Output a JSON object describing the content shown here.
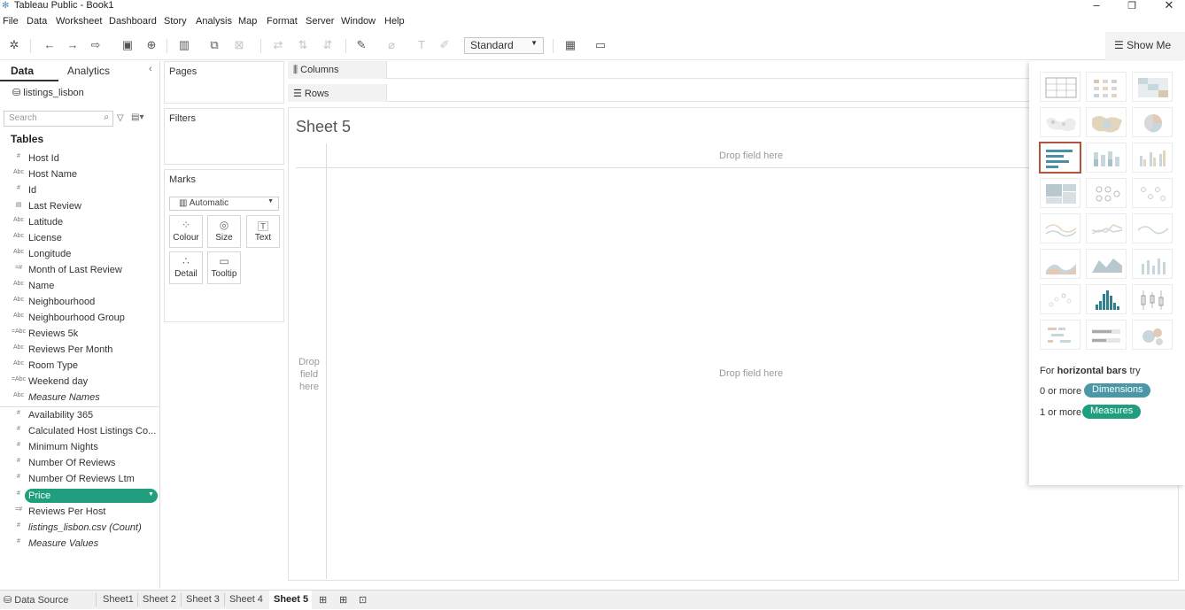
{
  "window": {
    "title": "Tableau Public - Book1",
    "minimize": "–",
    "restore": "❐",
    "close": "✕"
  },
  "menu": [
    "File",
    "Data",
    "Worksheet",
    "Dashboard",
    "Story",
    "Analysis",
    "Map",
    "Format",
    "Server",
    "Window",
    "Help"
  ],
  "toolbar": {
    "fit_select": "Standard",
    "show_me_label": "Show Me"
  },
  "datapane": {
    "tab_data": "Data",
    "tab_analytics": "Analytics",
    "datasource": "listings_lisbon",
    "search_placeholder": "Search",
    "tables_heading": "Tables",
    "fields": [
      {
        "icon": "#",
        "label": "Host Id"
      },
      {
        "icon": "Abc",
        "label": "Host Name"
      },
      {
        "icon": "#",
        "label": "Id"
      },
      {
        "icon": "▤",
        "label": "Last Review"
      },
      {
        "icon": "Abc",
        "label": "Latitude"
      },
      {
        "icon": "Abc",
        "label": "License"
      },
      {
        "icon": "Abc",
        "label": "Longitude"
      },
      {
        "icon": "=#",
        "label": "Month of Last Review"
      },
      {
        "icon": "Abc",
        "label": "Name"
      },
      {
        "icon": "Abc",
        "label": "Neighbourhood"
      },
      {
        "icon": "Abc",
        "label": "Neighbourhood Group"
      },
      {
        "icon": "=Abc",
        "label": "Reviews 5k"
      },
      {
        "icon": "Abc",
        "label": "Reviews Per Month"
      },
      {
        "icon": "Abc",
        "label": "Room Type"
      },
      {
        "icon": "=Abc",
        "label": "Weekend day"
      },
      {
        "icon": "Abc",
        "label": "Measure Names"
      }
    ],
    "measures": [
      {
        "icon": "#",
        "label": "Availability 365"
      },
      {
        "icon": "#",
        "label": "Calculated Host Listings Co..."
      },
      {
        "icon": "#",
        "label": "Minimum Nights"
      },
      {
        "icon": "#",
        "label": "Number Of Reviews"
      },
      {
        "icon": "#",
        "label": "Number Of Reviews Ltm"
      },
      {
        "icon": "#",
        "label": "Price"
      },
      {
        "icon": "=#",
        "label": "Reviews Per Host"
      },
      {
        "icon": "#",
        "label": "listings_lisbon.csv (Count)"
      },
      {
        "icon": "#",
        "label": "Measure Values"
      }
    ]
  },
  "cards": {
    "pages": "Pages",
    "filters": "Filters",
    "marks": "Marks",
    "mark_type": "Automatic",
    "mark_buttons": [
      "Colour",
      "Size",
      "Text",
      "Detail",
      "Tooltip"
    ]
  },
  "shelves": {
    "columns": "Columns",
    "rows": "Rows"
  },
  "sheet": {
    "title": "Sheet 5",
    "drop_top": "Drop field here",
    "drop_center": "Drop field here",
    "drop_left": [
      "Drop",
      "field",
      "here"
    ]
  },
  "showme": {
    "hint_prefix": "For ",
    "hint_bold": "horizontal bars",
    "hint_suffix": " try",
    "req1_prefix": "0 or more",
    "req1_badge": "Dimensions",
    "req2_prefix": "1 or more",
    "req2_badge": "Measures",
    "colors": {
      "dimension": "#4a97a8",
      "measure": "#1f9f7d",
      "selected_border": "#b3523e"
    }
  },
  "statusbar": {
    "datasource_tab": "Data Source",
    "sheets": [
      "Sheet1",
      "Sheet 2",
      "Sheet 3",
      "Sheet 4",
      "Sheet 5"
    ],
    "active_sheet": "Sheet 5"
  }
}
